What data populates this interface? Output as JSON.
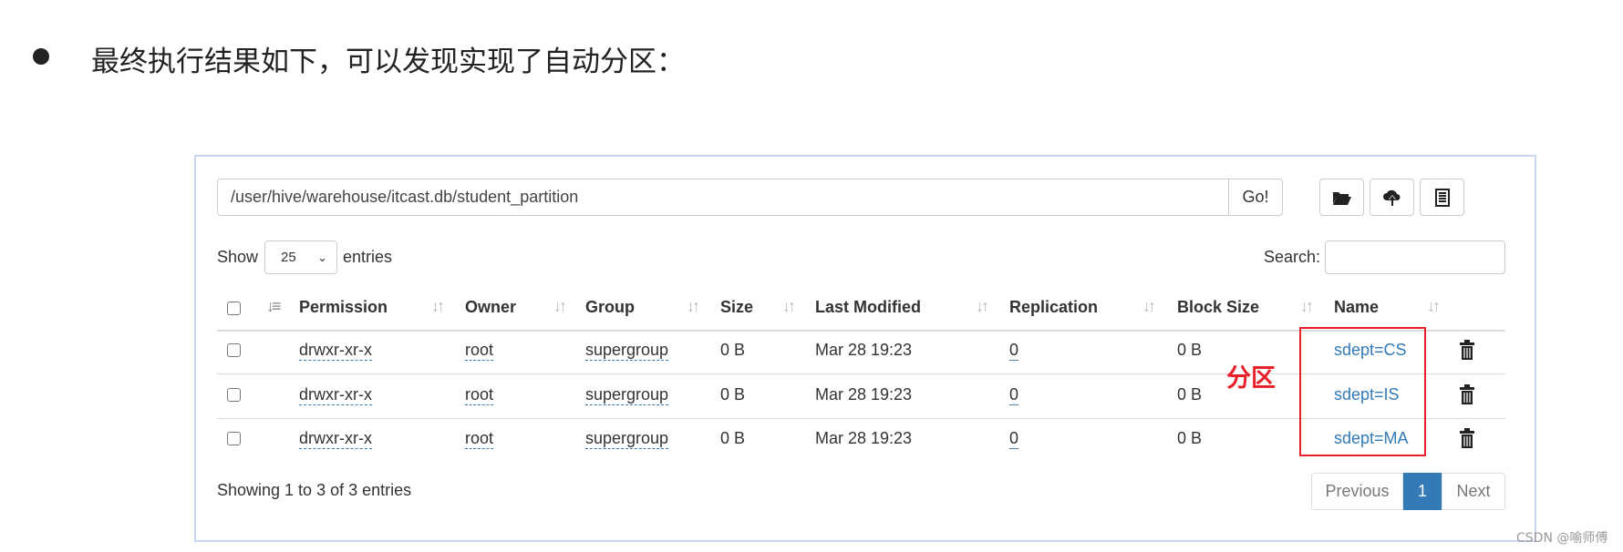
{
  "heading": "最终执行结果如下，可以发现实现了自动分区：",
  "path_input": "/user/hive/warehouse/itcast.db/student_partition",
  "go_label": "Go!",
  "toolbar": {
    "icons": [
      "folder-open-icon",
      "cloud-upload-icon",
      "list-icon"
    ]
  },
  "show_label": "Show",
  "entries_select": "25",
  "entries_label": "entries",
  "search_label": "Search:",
  "search_value": "",
  "columns": [
    "Permission",
    "Owner",
    "Group",
    "Size",
    "Last Modified",
    "Replication",
    "Block Size",
    "Name"
  ],
  "rows": [
    {
      "permission": "drwxr-xr-x",
      "owner": "root",
      "group": "supergroup",
      "size": "0 B",
      "modified": "Mar 28 19:23",
      "replication": "0",
      "block_size": "0 B",
      "name": "sdept=CS"
    },
    {
      "permission": "drwxr-xr-x",
      "owner": "root",
      "group": "supergroup",
      "size": "0 B",
      "modified": "Mar 28 19:23",
      "replication": "0",
      "block_size": "0 B",
      "name": "sdept=IS"
    },
    {
      "permission": "drwxr-xr-x",
      "owner": "root",
      "group": "supergroup",
      "size": "0 B",
      "modified": "Mar 28 19:23",
      "replication": "0",
      "block_size": "0 B",
      "name": "sdept=MA"
    }
  ],
  "annotation": "分区",
  "annotation_color": "#e8202a",
  "showing": "Showing 1 to 3 of 3 entries",
  "pagination": {
    "previous": "Previous",
    "current": "1",
    "next": "Next"
  },
  "accent": "#337ab7",
  "watermark": "CSDN @喻师傅"
}
